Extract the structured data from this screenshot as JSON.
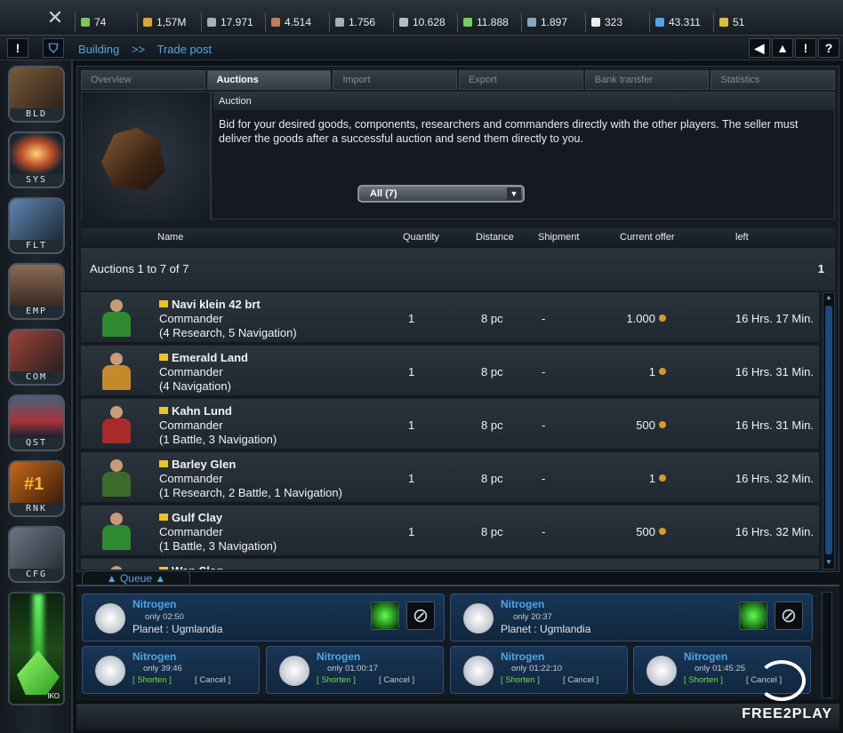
{
  "resources": [
    {
      "value": "74",
      "color": "#7cc95a"
    },
    {
      "value": "1,57M",
      "color": "#d7a43a"
    },
    {
      "value": "17.971",
      "color": "#9fb0bf"
    },
    {
      "value": "4.514",
      "color": "#c47a5a"
    },
    {
      "value": "1.756",
      "color": "#9fb0bf"
    },
    {
      "value": "10.628",
      "color": "#b4bcc4"
    },
    {
      "value": "11.888",
      "color": "#6ed05a"
    },
    {
      "value": "1.897",
      "color": "#8aa6c2"
    },
    {
      "value": "323",
      "color": "#e8ecef"
    },
    {
      "value": "43.311",
      "color": "#4ea6e6"
    },
    {
      "value": "51",
      "color": "#d7c13a"
    }
  ],
  "top_buttons": {
    "alert": "!",
    "back": "◀",
    "up": "▲",
    "hint": "!",
    "help": "?"
  },
  "breadcrumb": {
    "part1": "Building",
    "sep": ">>",
    "part2": "Trade post"
  },
  "sidebar": [
    {
      "label": "BLD"
    },
    {
      "label": "SYS"
    },
    {
      "label": "FLT"
    },
    {
      "label": "EMP"
    },
    {
      "label": "COM"
    },
    {
      "label": "QST"
    },
    {
      "label": "RNK",
      "badge": "#1"
    },
    {
      "label": "CFG"
    }
  ],
  "sidebar_crystal_label": "IKO",
  "tabs": [
    "Overview",
    "Auctions",
    "Import",
    "Export",
    "Bank transfer",
    "Statistics"
  ],
  "active_tab": "Auctions",
  "info": {
    "header": "Auction",
    "text": "Bid for your desired goods, components, researchers and commanders directly with the other players. The seller must deliver the goods after a successful auction and send them directly to you.",
    "filter": "All (7)"
  },
  "columns": {
    "name": "Name",
    "quantity": "Quantity",
    "distance": "Distance",
    "shipment": "Shipment",
    "offer": "Current offer",
    "left": "left"
  },
  "summary": {
    "text": "Auctions 1 to 7 of 7",
    "page": "1"
  },
  "auctions": [
    {
      "name": "Navi klein 42 brt",
      "type": "Commander",
      "skills": "(4 Research, 5 Navigation)",
      "qty": "1",
      "dist": "8 pc",
      "ship": "-",
      "offer": "1.000",
      "left": "16 Hrs. 17 Min."
    },
    {
      "name": "Emerald Land",
      "type": "Commander",
      "skills": "(4 Navigation)",
      "qty": "1",
      "dist": "8 pc",
      "ship": "-",
      "offer": "1",
      "left": "16 Hrs. 31 Min."
    },
    {
      "name": "Kahn Lund",
      "type": "Commander",
      "skills": "(1 Battle, 3 Navigation)",
      "qty": "1",
      "dist": "8 pc",
      "ship": "-",
      "offer": "500",
      "left": "16 Hrs. 31 Min."
    },
    {
      "name": "Barley Glen",
      "type": "Commander",
      "skills": "(1 Research, 2 Battle, 1 Navigation)",
      "qty": "1",
      "dist": "8 pc",
      "ship": "-",
      "offer": "1",
      "left": "16 Hrs. 32 Min."
    },
    {
      "name": "Gulf Clay",
      "type": "Commander",
      "skills": "(1 Battle, 3 Navigation)",
      "qty": "1",
      "dist": "8 pc",
      "ship": "-",
      "offer": "500",
      "left": "16 Hrs. 32 Min."
    },
    {
      "name": "Wan Slag",
      "type": "",
      "skills": "",
      "qty": "",
      "dist": "",
      "ship": "",
      "offer": "",
      "left": ""
    }
  ],
  "queue": {
    "tab_label": "▲ Queue ▲",
    "large": [
      {
        "title": "Nitrogen",
        "time": "only 02:50",
        "planet": "Planet : Ugmlandia"
      },
      {
        "title": "Nitrogen",
        "time": "only 20:37",
        "planet": "Planet : Ugmlandia"
      }
    ],
    "small": [
      {
        "title": "Nitrogen",
        "time": "only 39:46",
        "shorten": "[ Shorten ]",
        "cancel": "[ Cancel ]"
      },
      {
        "title": "Nitrogen",
        "time": "only 01:00:17",
        "shorten": "[ Shorten ]",
        "cancel": "[ Cancel ]"
      },
      {
        "title": "Nitrogen",
        "time": "only 01:22:10",
        "shorten": "[ Shorten ]",
        "cancel": "[ Cancel ]"
      },
      {
        "title": "Nitrogen",
        "time": "only 01:45:25",
        "shorten": "[ Shorten ]",
        "cancel": "[ Cancel ]"
      }
    ]
  },
  "logo": "FREE2PLAY"
}
